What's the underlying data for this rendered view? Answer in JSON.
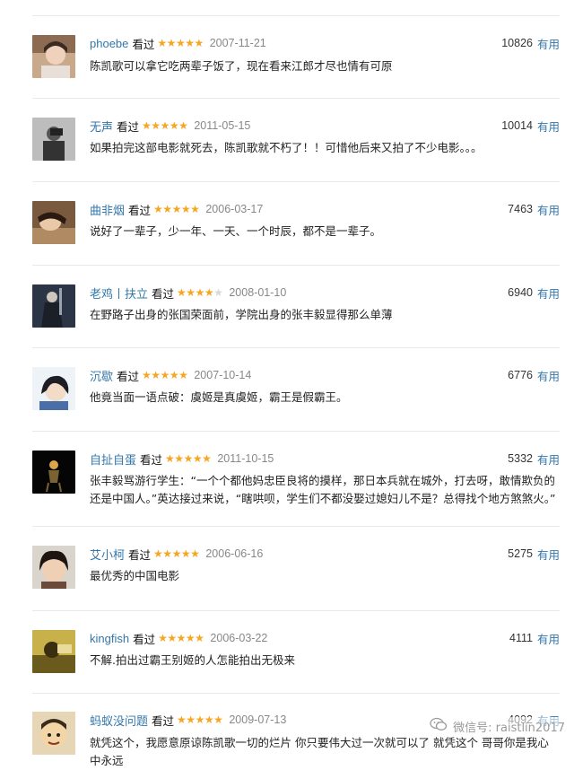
{
  "reviews": [
    {
      "user": "phoebe",
      "watched": "看过",
      "stars": 5,
      "date": "2007-11-21",
      "count": "10826",
      "useful": "有用",
      "text": "陈凯歌可以拿它吃两辈子饭了，现在看来江郎才尽也情有可原",
      "avatar": "photo-avatar"
    },
    {
      "user": "无声",
      "watched": "看过",
      "stars": 5,
      "date": "2011-05-15",
      "count": "10014",
      "useful": "有用",
      "text": "如果拍完这部电影就死去，陈凯歌就不朽了！！可惜他后来又拍了不少电影。。。",
      "avatar": "photo-avatar"
    },
    {
      "user": "曲非烟",
      "watched": "看过",
      "stars": 5,
      "date": "2006-03-17",
      "count": "7463",
      "useful": "有用",
      "text": "说好了一辈子，少一年、一天、一个时辰，都不是一辈子。",
      "avatar": "photo-avatar"
    },
    {
      "user": "老鸡丨扶立",
      "watched": "看过",
      "stars": 4,
      "date": "2008-01-10",
      "count": "6940",
      "useful": "有用",
      "text": "在野路子出身的张国荣面前，学院出身的张丰毅显得那么单薄",
      "avatar": "photo-avatar"
    },
    {
      "user": "沉歇",
      "watched": "看过",
      "stars": 5,
      "date": "2007-10-14",
      "count": "6776",
      "useful": "有用",
      "text": "他竟当面一语点破：虞姬是真虞姬，霸王是假霸王。",
      "avatar": "photo-avatar"
    },
    {
      "user": "自扯自蛋",
      "watched": "看过",
      "stars": 5,
      "date": "2011-10-15",
      "count": "5332",
      "useful": "有用",
      "text": "张丰毅骂游行学生：“一个个都他妈忠臣良将的摸样，那日本兵就在城外，打去呀，敢情欺负的还是中国人。”英达接过来说，“瞎哄呗，学生们不都没娶过媳妇儿不是？总得找个地方煞煞火。”",
      "avatar": "photo-avatar"
    },
    {
      "user": "艾小柯",
      "watched": "看过",
      "stars": 5,
      "date": "2006-06-16",
      "count": "5275",
      "useful": "有用",
      "text": "最优秀的中国电影",
      "avatar": "photo-avatar"
    },
    {
      "user": "kingfish",
      "watched": "看过",
      "stars": 5,
      "date": "2006-03-22",
      "count": "4111",
      "useful": "有用",
      "text": "不解.拍出过霸王别姬的人怎能拍出无极来",
      "avatar": "photo-avatar"
    },
    {
      "user": "蚂蚁没问题",
      "watched": "看过",
      "stars": 5,
      "date": "2009-07-13",
      "count": "4092",
      "useful": "有用",
      "text": "就凭这个，我愿意原谅陈凯歌一切的烂片 你只要伟大过一次就可以了 就凭这个 哥哥你是我心中永远",
      "avatar": "photo-avatar"
    }
  ],
  "watermark": {
    "icon": "wechat-icon",
    "text": "微信号: raistlin2017"
  },
  "colors": {
    "link": "#3377aa",
    "star": "#f5a623",
    "date": "#888888",
    "divider": "#e9e9e9"
  }
}
